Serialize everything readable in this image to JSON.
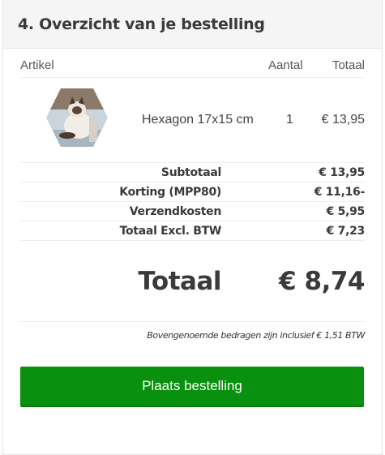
{
  "section": {
    "title": "4. Overzicht van je bestelling"
  },
  "table": {
    "headers": {
      "article": "Artikel",
      "quantity": "Aantal",
      "total": "Totaal"
    },
    "items": [
      {
        "name": "Hexagon 17x15 cm",
        "quantity": "1",
        "price": "€ 13,95",
        "thumbnail": "hexagon-cat-photo"
      }
    ]
  },
  "summary": {
    "subtotal_label": "Subtotaal",
    "subtotal_value": "€ 13,95",
    "discount_label": "Korting (MPP80)",
    "discount_value": "€ 11,16-",
    "shipping_label": "Verzendkosten",
    "shipping_value": "€ 5,95",
    "excl_vat_label": "Totaal Excl. BTW",
    "excl_vat_value": "€ 7,23",
    "total_label": "Totaal",
    "total_value": "€ 8,74",
    "vat_note": "Bovengenoemde bedragen zijn inclusief € 1,51 BTW"
  },
  "actions": {
    "place_order_label": "Plaats bestelling"
  },
  "colors": {
    "button_green": "#0a900f",
    "header_bg": "#f5f5f5"
  }
}
